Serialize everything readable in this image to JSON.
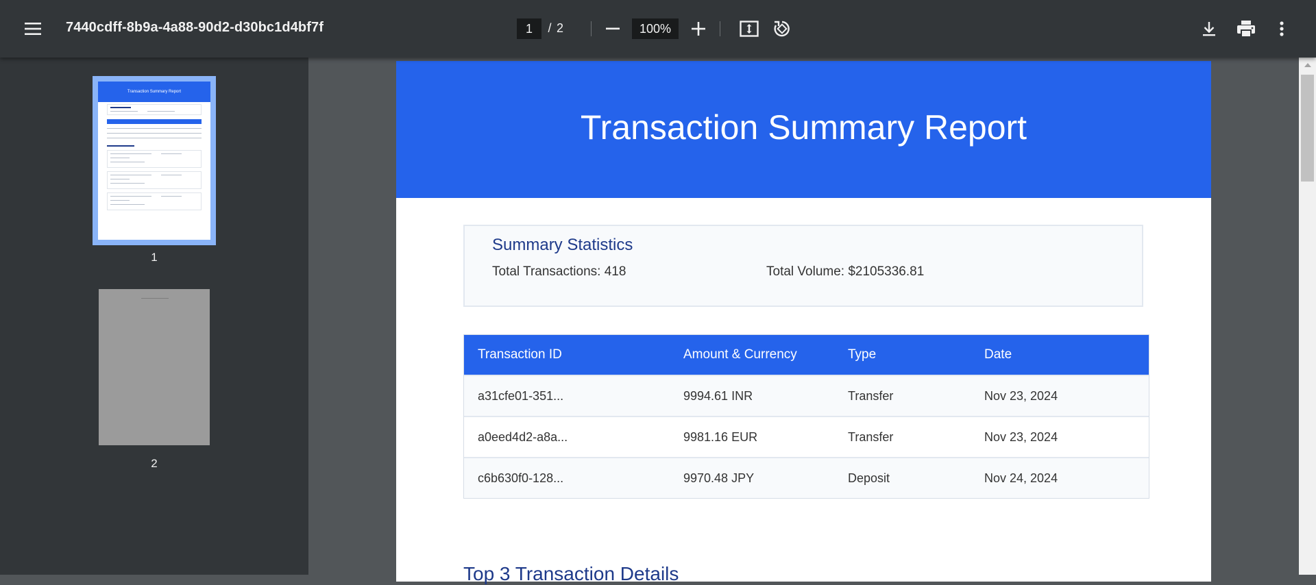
{
  "toolbar": {
    "title": "7440cdff-8b9a-4a88-90d2-d30bc1d4bf7f",
    "current_page": "1",
    "page_separator": "/",
    "total_pages": "2",
    "zoom": "100%",
    "icons": [
      "menu-icon",
      "zoom-out-icon",
      "zoom-in-icon",
      "fit-page-icon",
      "rotate-icon",
      "download-icon",
      "print-icon",
      "more-vert-icon"
    ]
  },
  "sidebar": {
    "thumbnails": [
      {
        "label": "1",
        "title": "Transaction Summary Report"
      },
      {
        "label": "2"
      }
    ]
  },
  "report": {
    "title": "Transaction Summary Report",
    "summary": {
      "heading": "Summary Statistics",
      "total_transactions": "Total Transactions: 418",
      "total_volume": "Total Volume: $2105336.81"
    },
    "table": {
      "headers": [
        "Transaction ID",
        "Amount & Currency",
        "Type",
        "Date"
      ],
      "rows": [
        [
          "a31cfe01-351...",
          "9994.61 INR",
          "Transfer",
          "Nov 23, 2024"
        ],
        [
          "a0eed4d2-a8a...",
          "9981.16 EUR",
          "Transfer",
          "Nov 23, 2024"
        ],
        [
          "c6b630f0-128...",
          "9970.48 JPY",
          "Deposit",
          "Nov 24, 2024"
        ]
      ]
    },
    "section_title": "Top 3 Transaction Details"
  },
  "colors": {
    "toolbar_bg": "#323639",
    "viewer_bg": "#525659",
    "accent_blue": "#2563eb",
    "heading_navy": "#1e3a8a",
    "thumb_selected": "#8ab4f8"
  }
}
